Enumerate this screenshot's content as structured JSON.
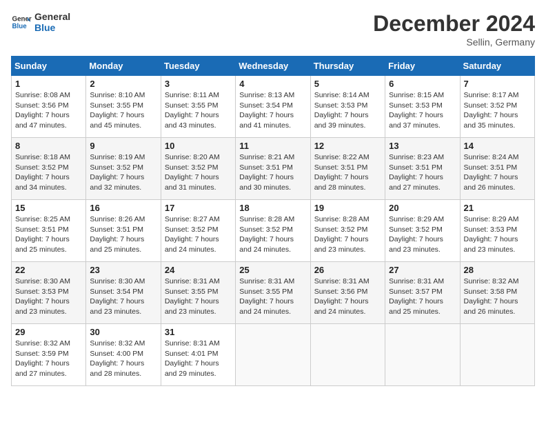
{
  "header": {
    "logo_line1": "General",
    "logo_line2": "Blue",
    "month": "December 2024",
    "location": "Sellin, Germany"
  },
  "weekdays": [
    "Sunday",
    "Monday",
    "Tuesday",
    "Wednesday",
    "Thursday",
    "Friday",
    "Saturday"
  ],
  "weeks": [
    [
      {
        "day": "1",
        "lines": [
          "Sunrise: 8:08 AM",
          "Sunset: 3:56 PM",
          "Daylight: 7 hours",
          "and 47 minutes."
        ]
      },
      {
        "day": "2",
        "lines": [
          "Sunrise: 8:10 AM",
          "Sunset: 3:55 PM",
          "Daylight: 7 hours",
          "and 45 minutes."
        ]
      },
      {
        "day": "3",
        "lines": [
          "Sunrise: 8:11 AM",
          "Sunset: 3:55 PM",
          "Daylight: 7 hours",
          "and 43 minutes."
        ]
      },
      {
        "day": "4",
        "lines": [
          "Sunrise: 8:13 AM",
          "Sunset: 3:54 PM",
          "Daylight: 7 hours",
          "and 41 minutes."
        ]
      },
      {
        "day": "5",
        "lines": [
          "Sunrise: 8:14 AM",
          "Sunset: 3:53 PM",
          "Daylight: 7 hours",
          "and 39 minutes."
        ]
      },
      {
        "day": "6",
        "lines": [
          "Sunrise: 8:15 AM",
          "Sunset: 3:53 PM",
          "Daylight: 7 hours",
          "and 37 minutes."
        ]
      },
      {
        "day": "7",
        "lines": [
          "Sunrise: 8:17 AM",
          "Sunset: 3:52 PM",
          "Daylight: 7 hours",
          "and 35 minutes."
        ]
      }
    ],
    [
      {
        "day": "8",
        "lines": [
          "Sunrise: 8:18 AM",
          "Sunset: 3:52 PM",
          "Daylight: 7 hours",
          "and 34 minutes."
        ]
      },
      {
        "day": "9",
        "lines": [
          "Sunrise: 8:19 AM",
          "Sunset: 3:52 PM",
          "Daylight: 7 hours",
          "and 32 minutes."
        ]
      },
      {
        "day": "10",
        "lines": [
          "Sunrise: 8:20 AM",
          "Sunset: 3:52 PM",
          "Daylight: 7 hours",
          "and 31 minutes."
        ]
      },
      {
        "day": "11",
        "lines": [
          "Sunrise: 8:21 AM",
          "Sunset: 3:51 PM",
          "Daylight: 7 hours",
          "and 30 minutes."
        ]
      },
      {
        "day": "12",
        "lines": [
          "Sunrise: 8:22 AM",
          "Sunset: 3:51 PM",
          "Daylight: 7 hours",
          "and 28 minutes."
        ]
      },
      {
        "day": "13",
        "lines": [
          "Sunrise: 8:23 AM",
          "Sunset: 3:51 PM",
          "Daylight: 7 hours",
          "and 27 minutes."
        ]
      },
      {
        "day": "14",
        "lines": [
          "Sunrise: 8:24 AM",
          "Sunset: 3:51 PM",
          "Daylight: 7 hours",
          "and 26 minutes."
        ]
      }
    ],
    [
      {
        "day": "15",
        "lines": [
          "Sunrise: 8:25 AM",
          "Sunset: 3:51 PM",
          "Daylight: 7 hours",
          "and 25 minutes."
        ]
      },
      {
        "day": "16",
        "lines": [
          "Sunrise: 8:26 AM",
          "Sunset: 3:51 PM",
          "Daylight: 7 hours",
          "and 25 minutes."
        ]
      },
      {
        "day": "17",
        "lines": [
          "Sunrise: 8:27 AM",
          "Sunset: 3:52 PM",
          "Daylight: 7 hours",
          "and 24 minutes."
        ]
      },
      {
        "day": "18",
        "lines": [
          "Sunrise: 8:28 AM",
          "Sunset: 3:52 PM",
          "Daylight: 7 hours",
          "and 24 minutes."
        ]
      },
      {
        "day": "19",
        "lines": [
          "Sunrise: 8:28 AM",
          "Sunset: 3:52 PM",
          "Daylight: 7 hours",
          "and 23 minutes."
        ]
      },
      {
        "day": "20",
        "lines": [
          "Sunrise: 8:29 AM",
          "Sunset: 3:52 PM",
          "Daylight: 7 hours",
          "and 23 minutes."
        ]
      },
      {
        "day": "21",
        "lines": [
          "Sunrise: 8:29 AM",
          "Sunset: 3:53 PM",
          "Daylight: 7 hours",
          "and 23 minutes."
        ]
      }
    ],
    [
      {
        "day": "22",
        "lines": [
          "Sunrise: 8:30 AM",
          "Sunset: 3:53 PM",
          "Daylight: 7 hours",
          "and 23 minutes."
        ]
      },
      {
        "day": "23",
        "lines": [
          "Sunrise: 8:30 AM",
          "Sunset: 3:54 PM",
          "Daylight: 7 hours",
          "and 23 minutes."
        ]
      },
      {
        "day": "24",
        "lines": [
          "Sunrise: 8:31 AM",
          "Sunset: 3:55 PM",
          "Daylight: 7 hours",
          "and 23 minutes."
        ]
      },
      {
        "day": "25",
        "lines": [
          "Sunrise: 8:31 AM",
          "Sunset: 3:55 PM",
          "Daylight: 7 hours",
          "and 24 minutes."
        ]
      },
      {
        "day": "26",
        "lines": [
          "Sunrise: 8:31 AM",
          "Sunset: 3:56 PM",
          "Daylight: 7 hours",
          "and 24 minutes."
        ]
      },
      {
        "day": "27",
        "lines": [
          "Sunrise: 8:31 AM",
          "Sunset: 3:57 PM",
          "Daylight: 7 hours",
          "and 25 minutes."
        ]
      },
      {
        "day": "28",
        "lines": [
          "Sunrise: 8:32 AM",
          "Sunset: 3:58 PM",
          "Daylight: 7 hours",
          "and 26 minutes."
        ]
      }
    ],
    [
      {
        "day": "29",
        "lines": [
          "Sunrise: 8:32 AM",
          "Sunset: 3:59 PM",
          "Daylight: 7 hours",
          "and 27 minutes."
        ]
      },
      {
        "day": "30",
        "lines": [
          "Sunrise: 8:32 AM",
          "Sunset: 4:00 PM",
          "Daylight: 7 hours",
          "and 28 minutes."
        ]
      },
      {
        "day": "31",
        "lines": [
          "Sunrise: 8:31 AM",
          "Sunset: 4:01 PM",
          "Daylight: 7 hours",
          "and 29 minutes."
        ]
      },
      null,
      null,
      null,
      null
    ]
  ]
}
